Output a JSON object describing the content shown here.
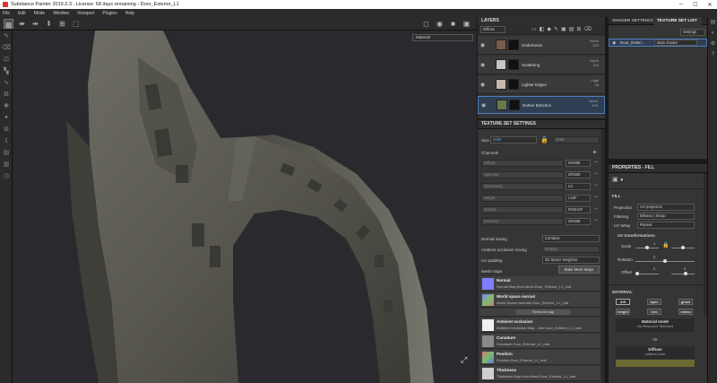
{
  "window": {
    "title": "Substance Painter 2019.2.3 - License: 68 days remaining - Door_Exterior_L1"
  },
  "menu": [
    "File",
    "Edit",
    "Mode",
    "Window",
    "Viewport",
    "Plugins",
    "Help"
  ],
  "viewport": {
    "mode_select": "Material"
  },
  "layers": {
    "title": "LAYERS",
    "channel_select": "Diffuse",
    "items": [
      {
        "name": "Undertones",
        "blend": "Norm",
        "opacity": "100"
      },
      {
        "name": "Scattering",
        "blend": "Norm",
        "opacity": "100"
      },
      {
        "name": "Lighter Edges",
        "blend": "Ldge",
        "opacity": "25"
      },
      {
        "name": "Darker Blotches",
        "blend": "Norm",
        "opacity": "100"
      }
    ]
  },
  "texture_set_settings": {
    "title": "TEXTURE SET SETTINGS",
    "size_label": "Size",
    "size_value": "4096",
    "size_value2": "4096",
    "channels_label": "Channels",
    "channels": [
      {
        "name": "Diffuse",
        "format": "sRGB8"
      },
      {
        "name": "Specular",
        "format": "sRGB8"
      },
      {
        "name": "Glossiness",
        "format": "L8"
      },
      {
        "name": "Height",
        "format": "L16F"
      },
      {
        "name": "Normal",
        "format": "RGB16F"
      },
      {
        "name": "Emissive",
        "format": "sRGB8"
      }
    ],
    "normal_mixing_label": "Normal mixing",
    "normal_mixing_value": "Combine",
    "ao_mixing_label": "Ambient occlusion mixing",
    "ao_mixing_value": "Multiply",
    "uv_padding_label": "UV padding",
    "uv_padding_value": "3D Space Neighbor",
    "mesh_maps_label": "Mesh maps",
    "bake_button": "Bake Mesh Maps",
    "mesh_maps": [
      {
        "title": "Normal",
        "sub": "Normal Map from Mesh Door_Exterior_L1_mat",
        "color": "#7f7fff",
        "button": ""
      },
      {
        "title": "World space normal",
        "sub": "World Space Normals Door_Exterior_L1_mat",
        "color": "#6fa06f",
        "button": "Select id map"
      },
      {
        "title": "Ambient occlusion",
        "sub": "Ambient Occlusion Map ...esh Door_Exterior_L1_mat",
        "color": "#f0f0f0",
        "button": ""
      },
      {
        "title": "Curvature",
        "sub": "Curvature Door_Exterior_L1_mat",
        "color": "#8a8a8a",
        "button": ""
      },
      {
        "title": "Position",
        "sub": "Position Door_Exterior_L1_mat",
        "color": "#c97a9a",
        "button": ""
      },
      {
        "title": "Thickness",
        "sub": "Thickness Map from Mesh Door_Exterior_L1_mat",
        "color": "#cfcfcf",
        "button": ""
      }
    ]
  },
  "shader": {
    "tab1": "SHADER SETTINGS",
    "tab2": "TEXTURE SET LIST",
    "settings_label": "Settings",
    "item_name": "Door_Exteri...",
    "item_shader": "Main shader"
  },
  "properties": {
    "title": "PROPERTIES - FILL",
    "fill_label": "FILL",
    "projection_label": "Projection",
    "projection_value": "UV projection",
    "filtering_label": "Filtering",
    "filtering_value": "Bilinear | Sharp",
    "uvwrap_label": "UV Wrap",
    "uvwrap_value": "Repeat",
    "uv_transform_label": "UV transformations",
    "scale_label": "Scale",
    "scale_value": "1",
    "rotation_label": "Rotation",
    "rotation_value": "0",
    "offset_label": "Offset",
    "offset_x": "0",
    "offset_y": "0",
    "material_label": "MATERIAL",
    "channel_buttons": [
      "diff",
      "spec",
      "gloss",
      "height",
      "nrm",
      "emiss"
    ],
    "material_mode_label": "Material mode",
    "material_mode_value": "No Resource Selected",
    "or_label": "Or",
    "diffuse_label": "Diffuse",
    "diffuse_sub": "uniform color",
    "diffuse_color": "#6b6a32"
  }
}
